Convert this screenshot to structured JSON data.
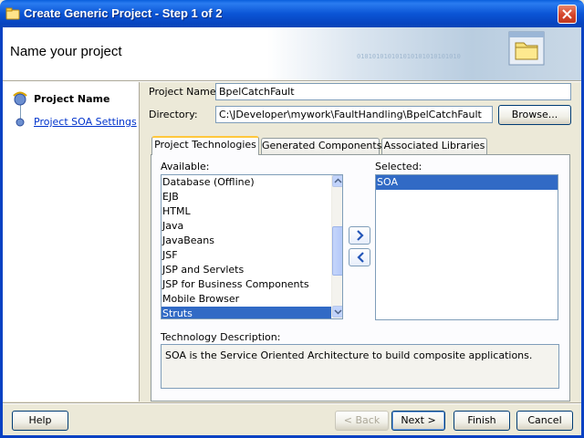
{
  "window": {
    "title": "Create Generic Project - Step 1 of 2"
  },
  "header": {
    "title": "Name your project",
    "binary_decor": "010101010101010101010101010"
  },
  "nav": {
    "items": [
      {
        "label": "Project Name",
        "state": "current"
      },
      {
        "label": "Project SOA Settings",
        "state": "link"
      }
    ]
  },
  "form": {
    "project_name_label": "Project Name:",
    "project_name_value": "BpelCatchFault",
    "directory_label": "Directory:",
    "directory_value": "C:\\JDeveloper\\mywork\\FaultHandling\\BpelCatchFault",
    "browse_label": "Browse..."
  },
  "tabs": [
    {
      "label": "Project Technologies",
      "active": true
    },
    {
      "label": "Generated Components",
      "active": false
    },
    {
      "label": "Associated Libraries",
      "active": false
    }
  ],
  "available": {
    "label": "Available:",
    "items": [
      "Database (Offline)",
      "EJB",
      "HTML",
      "Java",
      "JavaBeans",
      "JSF",
      "JSP and Servlets",
      "JSP for Business Components",
      "Mobile Browser",
      "Struts"
    ],
    "selected_item": "Struts"
  },
  "selected": {
    "label": "Selected:",
    "items": [
      "SOA"
    ]
  },
  "technology_description": {
    "label": "Technology Description:",
    "text": "SOA is the Service Oriented Architecture to build composite applications."
  },
  "buttons": {
    "help": "Help",
    "back": "< Back",
    "next": "Next >",
    "finish": "Finish",
    "cancel": "Cancel"
  },
  "colors": {
    "titlebar": "#0a55d6",
    "selection": "#316ac5",
    "link": "#0033cc",
    "active_tab_accent": "#ffc73c"
  }
}
